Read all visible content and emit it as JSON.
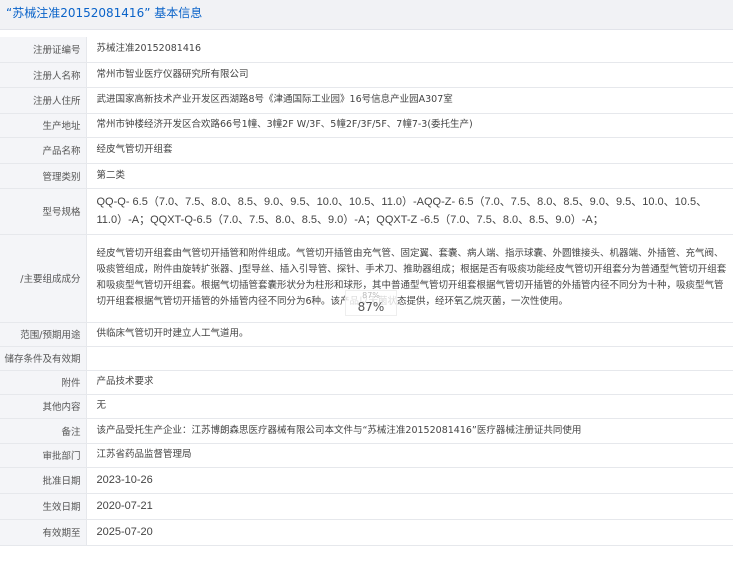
{
  "header": {
    "title": "“苏械注准20152081416” 基本信息"
  },
  "rows": [
    {
      "label": "注册证编号",
      "value": "苏械注准20152081416"
    },
    {
      "label": "注册人名称",
      "value": "常州市智业医疗仪器研究所有限公司"
    },
    {
      "label": "注册人住所",
      "value": "武进国家高新技术产业开发区西湖路8号《津通国际工业园》16号信息产业园A307室"
    },
    {
      "label": "生产地址",
      "value": "常州市钟楼经济开发区合欢路66号1幢、3幢2F W/3F、5幢2F/3F/5F、7幢7-3(委托生产)"
    },
    {
      "label": "产品名称",
      "value": "经皮气管切开组套"
    },
    {
      "label": "管理类别",
      "value": "第二类"
    },
    {
      "label": "型号规格",
      "value": "QQ-Q- 6.5（7.0、7.5、8.0、8.5、9.0、9.5、10.0、10.5、11.0）-AQQ-Z- 6.5（7.0、7.5、8.0、8.5、9.0、9.5、10.0、10.5、11.0）-A；QQXT-Q-6.5（7.0、7.5、8.0、8.5、9.0）-A；QQXT-Z -6.5（7.0、7.5、8.0、8.5、9.0）-A；"
    },
    {
      "label": "/主要组成成分",
      "value": "经皮气管切开组套由气管切开插管和附件组成。气管切开插管由充气管、固定翼、套囊、病人端、指示球囊、外圆锥接头、机器端、外插管、充气阀、吸痰管组成，附件由旋转扩张器、J型导丝、插入引导管、探针、手术刀、推助器组成；根据是否有吸痰功能经皮气管切开组套分为普通型气管切开组套和吸痰型气管切开组套。根据气切插管套囊形状分为柱形和球形，其中普通型气管切开组套根据气管切开插管的外插管内径不同分为十种，吸痰型气管切开组套根据气管切开插管的外插管内径不同分为6种。该产品以无菌状态提供，经环氧乙烷灭菌，一次性使用。"
    },
    {
      "label": "范围/预期用途",
      "value": "供临床气管切开时建立人工气道用。"
    },
    {
      "label": "储存条件及有效期",
      "value": ""
    },
    {
      "label": "附件",
      "value": "产品技术要求"
    },
    {
      "label": "其他内容",
      "value": "无"
    },
    {
      "label": "备注",
      "value": "该产品受托生产企业：江苏博朗森思医疗器械有限公司本文件与“苏械注准20152081416”医疗器械注册证共同使用"
    },
    {
      "label": "审批部门",
      "value": "江苏省药品监督管理局"
    },
    {
      "label": "批准日期",
      "value": "2023-10-26"
    },
    {
      "label": "生效日期",
      "value": "2020-07-21"
    },
    {
      "label": "有效期至",
      "value": "2025-07-20"
    }
  ],
  "overlay": {
    "ghost": "87%",
    "percent": "87%"
  }
}
